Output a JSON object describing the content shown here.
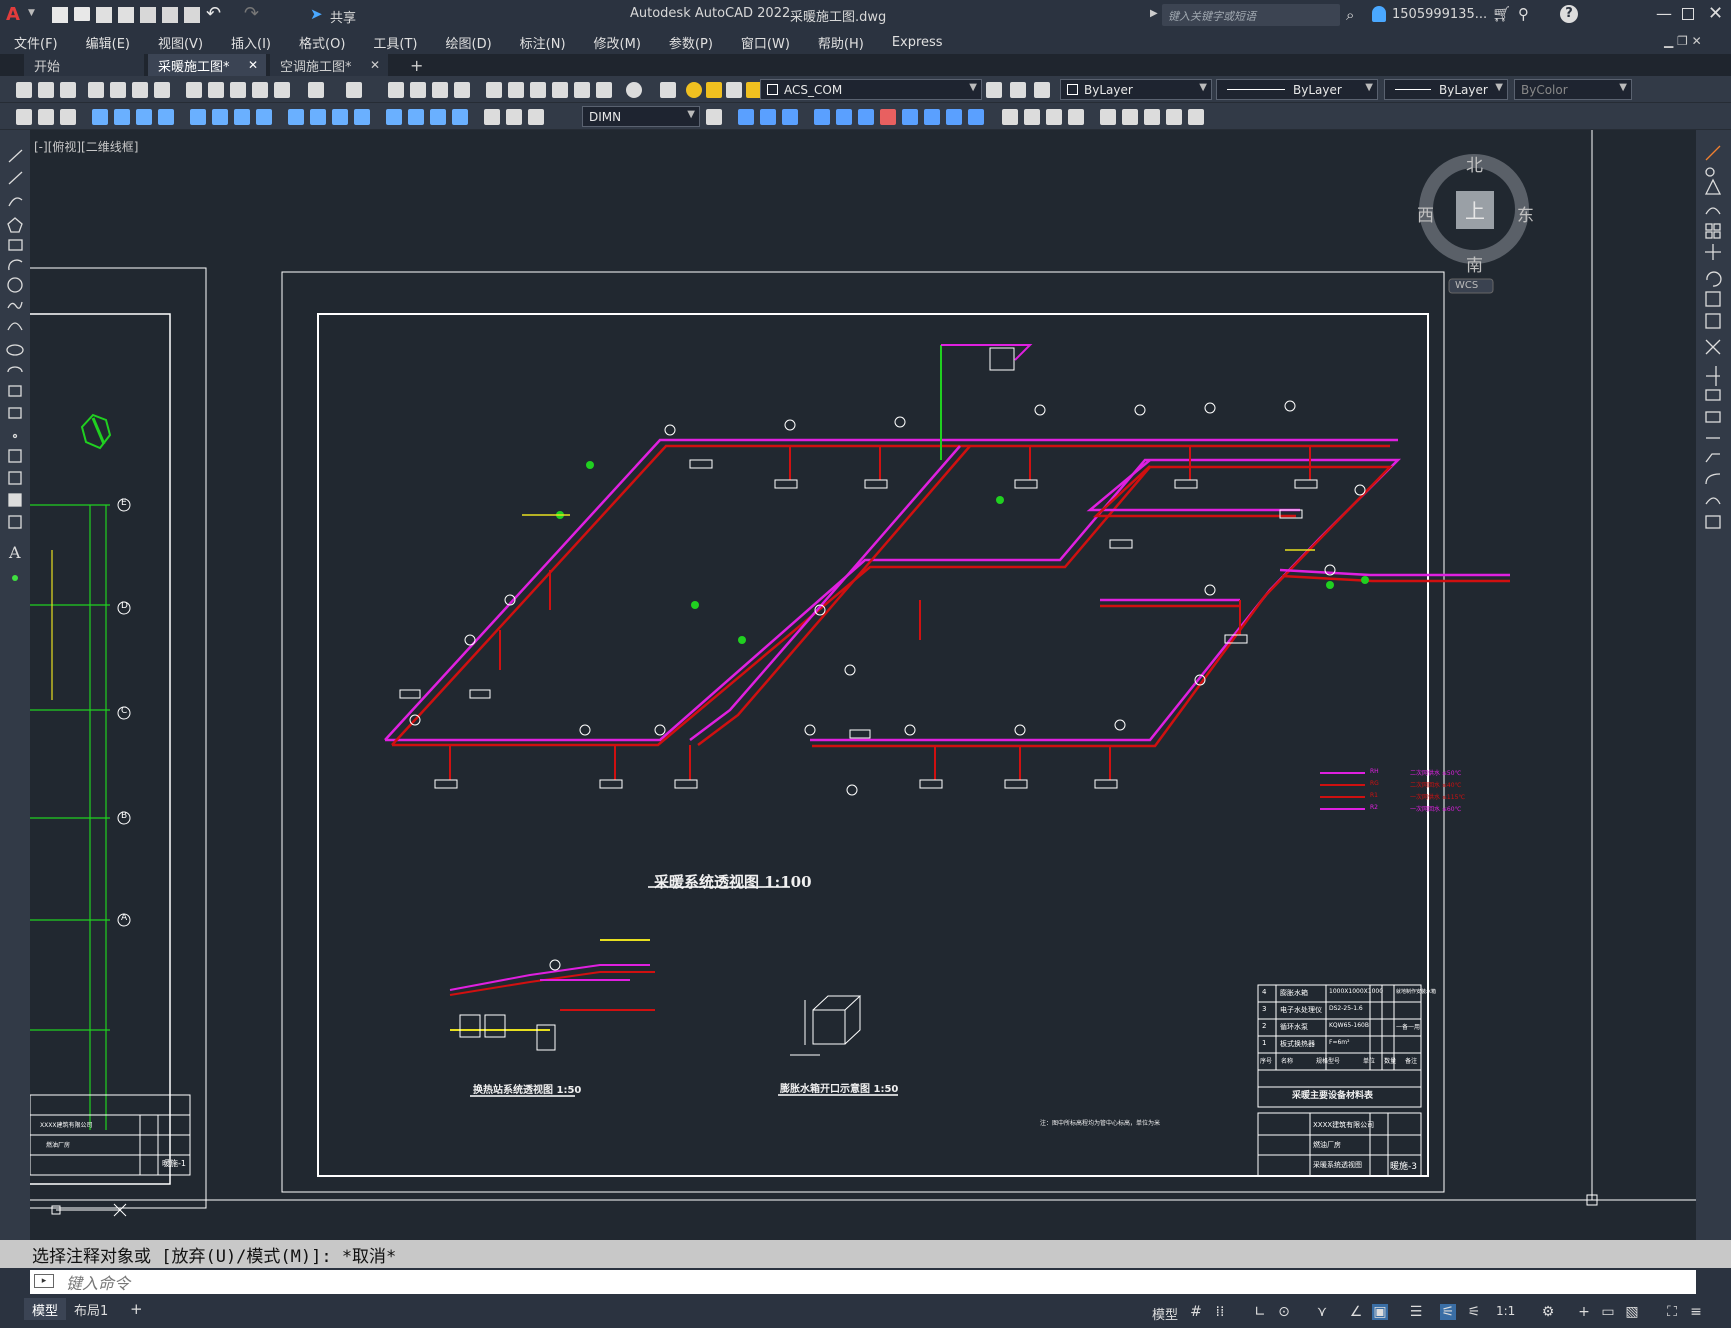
{
  "app": {
    "title": "Autodesk AutoCAD 2022",
    "file": "采暖施工图.dwg",
    "share": "共享",
    "search_placeholder": "键入关键字或短语",
    "user": "1505999135..."
  },
  "menu": [
    "文件(F)",
    "编辑(E)",
    "视图(V)",
    "插入(I)",
    "格式(O)",
    "工具(T)",
    "绘图(D)",
    "标注(N)",
    "修改(M)",
    "参数(P)",
    "窗口(W)",
    "帮助(H)",
    "Express"
  ],
  "tabs": {
    "start": "开始",
    "active": "采暖施工图*",
    "second": "空调施工图*"
  },
  "toolbar": {
    "ucs": "ACS_COM",
    "layer_color": "ByLayer",
    "linetype": "ByLayer",
    "lineweight": "ByLayer",
    "plotstyle": "ByColor",
    "dimstyle": "DIMN"
  },
  "viewport": {
    "label": "[-][俯视][二维线框]",
    "compass": {
      "n": "北",
      "s": "南",
      "e": "东",
      "w": "西",
      "top": "上",
      "wcs": "WCS"
    }
  },
  "drawing": {
    "main_title": "采暖系统透视图 1:100",
    "sub_title_1": "换热站系统透视图 1:50",
    "sub_title_2": "膨胀水箱开口示意图 1:50",
    "table_title": "采暖主要设备材料表",
    "table_header": [
      "序号",
      "名称",
      "规格型号",
      "单位",
      "数量",
      "备注"
    ],
    "table_rows": [
      [
        "4",
        "膨胀水箱",
        "1000X1000X1000",
        "个",
        "1",
        "就地制作安装水箱"
      ],
      [
        "3",
        "电子水处理仪",
        "DS2-25-1.6",
        "台",
        "1",
        ""
      ],
      [
        "2",
        "循环水泵",
        "KQW65-160B",
        "台",
        "2",
        "一备一用"
      ],
      [
        "1",
        "板式换热器",
        "F=6m²",
        "台",
        "1",
        ""
      ]
    ],
    "titleblock_company": "XXXX建筑有限公司",
    "titleblock_project": "燃油厂房",
    "titleblock_name": "采暖系统透视图",
    "titleblock_sheet": "暖施-3",
    "left_sheet": "暖施-1",
    "left_company": "XXXX建筑有限公司",
    "left_project": "燃油厂房",
    "note": "注：图中所标高程均为管中心标高，单位为米",
    "legend": [
      {
        "code": "RH",
        "text": "二次网供水 ≤50℃"
      },
      {
        "code": "RG",
        "text": "二次网回水 ≤40℃"
      },
      {
        "code": "R1",
        "text": "一次网供水 ≤115℃"
      },
      {
        "code": "R2",
        "text": "一次网回水 ≤60℃"
      }
    ],
    "axis_labels": [
      "E",
      "D",
      "C",
      "B",
      "A"
    ]
  },
  "command": {
    "history": "选择注释对象或 [放弃(U)/模式(M)]: *取消*",
    "placeholder": "键入命令"
  },
  "status": {
    "model_tab": "模型",
    "layout_tab": "布局1",
    "model_btn": "模型",
    "scale": "1:1"
  },
  "colors": {
    "background": "#212830",
    "pipe_supply": "#e020e0",
    "pipe_return": "#d01010",
    "frame": "#ffffff",
    "green": "#20e020",
    "yellow": "#e8e020"
  }
}
